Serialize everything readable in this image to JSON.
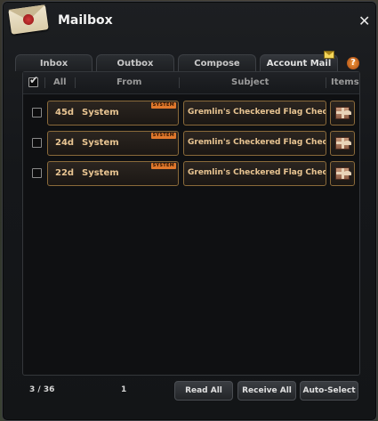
{
  "window": {
    "title": "Mailbox",
    "close_icon": "close-icon"
  },
  "tabs": [
    {
      "label": "Inbox"
    },
    {
      "label": "Outbox"
    },
    {
      "label": "Compose"
    },
    {
      "label": "Account Mail",
      "active": true,
      "badge_icon": "envelope-icon"
    }
  ],
  "help": {
    "label": "?"
  },
  "columns": {
    "all": "All",
    "from": "From",
    "subject": "Subject",
    "items": "Items"
  },
  "mails": [
    {
      "days": "45d",
      "sender": "System",
      "badge": "SYSTEM",
      "subject": "Gremlin's Checkered Flag Check-In Reward",
      "item_icon": "gift-box-icon"
    },
    {
      "days": "24d",
      "sender": "System",
      "badge": "SYSTEM",
      "subject": "Gremlin's Checkered Flag Check-In Reward",
      "item_icon": "gift-box-icon"
    },
    {
      "days": "22d",
      "sender": "System",
      "badge": "SYSTEM",
      "subject": "Gremlin's Checkered Flag Check-In Reward",
      "item_icon": "gift-box-icon"
    }
  ],
  "footer": {
    "count": "3 / 36",
    "page": "1",
    "read_all": "Read All",
    "receive_all": "Receive All",
    "auto_select": "Auto-Select"
  },
  "colors": {
    "accent_text": "#e9c592",
    "cell_border": "#8a6a3a",
    "system_badge": "#e0782c"
  }
}
